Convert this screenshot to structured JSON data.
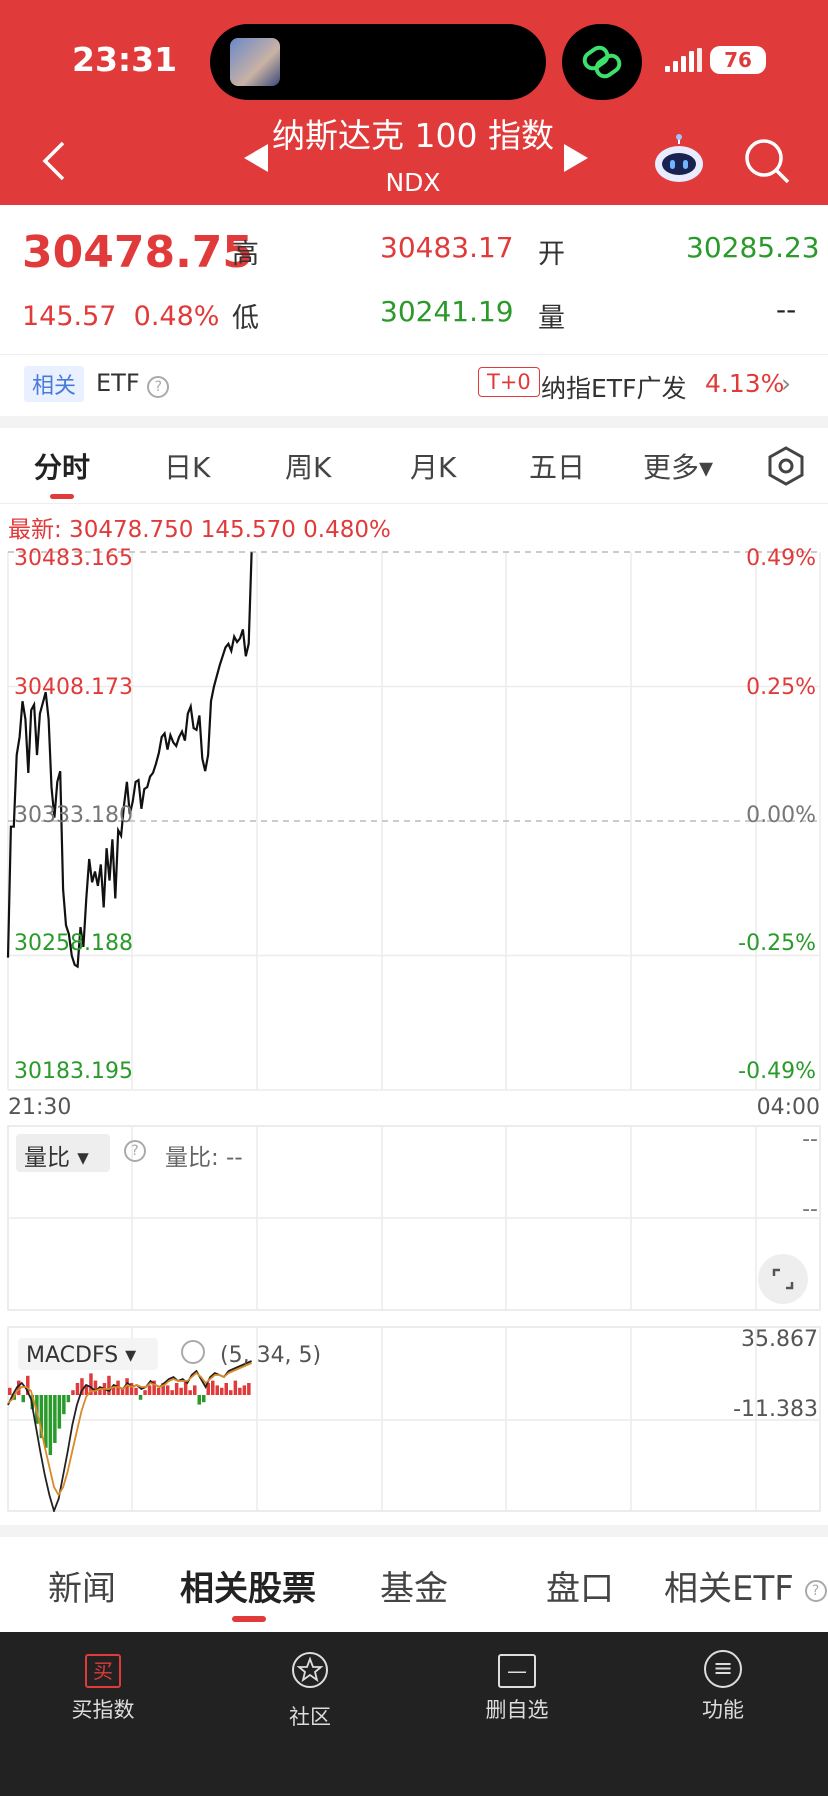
{
  "status": {
    "time": "23:31",
    "battery": "76"
  },
  "header": {
    "title": "纳斯达克 100 指数",
    "subtitle": "NDX"
  },
  "quote": {
    "price": "30478.75",
    "change": "145.57",
    "change_pct": "0.48%",
    "high_label": "高",
    "high": "30483.17",
    "open_label": "开",
    "open": "30285.23",
    "low_label": "低",
    "low": "30241.19",
    "volume_label": "量",
    "volume": "--"
  },
  "related": {
    "tag": "相关",
    "etf_label": "ETF",
    "t0_badge": "T+0",
    "fund_name": "纳指ETF广发",
    "fund_pct": "4.13%"
  },
  "period_tabs": [
    {
      "label": "分时",
      "active": true
    },
    {
      "label": "日K"
    },
    {
      "label": "周K"
    },
    {
      "label": "月K"
    },
    {
      "label": "五日"
    },
    {
      "label": "更多▾"
    }
  ],
  "latest_line": "最新: 30478.750  145.570  0.480%",
  "chart_data": {
    "type": "line",
    "x_start_label": "21:30",
    "x_end_label": "04:00",
    "y_labels": [
      "30483.165",
      "30408.173",
      "30333.180",
      "30258.188",
      "30183.195"
    ],
    "y_pct_labels": [
      "0.49%",
      "0.25%",
      "0.00%",
      "-0.25%",
      "-0.49%"
    ],
    "prev_close": 30333.18,
    "ylim": [
      30183.195,
      30483.165
    ],
    "x_session_fraction_shown": 0.3,
    "series": [
      {
        "values": [
          30257,
          30330,
          30330,
          30370,
          30380,
          30400,
          30390,
          30360,
          30395,
          30398,
          30370,
          30393,
          30399,
          30405,
          30390,
          30352,
          30335,
          30355,
          30361,
          30295,
          30275,
          30270,
          30258,
          30253,
          30252,
          30274,
          30263,
          30290,
          30312,
          30299,
          30305,
          30297,
          30309,
          30285,
          30318,
          30300,
          30323,
          30290,
          30328,
          30325,
          30342,
          30355,
          30337,
          30344,
          30355,
          30356,
          30340,
          30351,
          30352,
          30358,
          30360,
          30365,
          30371,
          30380,
          30382,
          30373,
          30381,
          30377,
          30375,
          30380,
          30383,
          30378,
          30393,
          30397,
          30385,
          30384,
          30392,
          30368,
          30361,
          30370,
          30400,
          30408,
          30414,
          30420,
          30425,
          30430,
          30432,
          30428,
          30436,
          30433,
          30435,
          30440,
          30425,
          30432,
          30483
        ]
      }
    ]
  },
  "volume_ratio": {
    "label": "量比",
    "text": "量比: --",
    "scale_top": "--",
    "scale_bottom": "--"
  },
  "macd": {
    "label": "MACDFS",
    "params": "(5, 34, 5)",
    "upper": "35.867",
    "lower": "-11.383",
    "hist": [
      3,
      -2,
      6,
      -3,
      8,
      -6,
      -12,
      -18,
      -22,
      -25,
      -20,
      -14,
      -8,
      -3,
      2,
      5,
      7,
      4,
      9,
      6,
      3,
      5,
      8,
      4,
      6,
      3,
      7,
      5,
      3,
      -2,
      2,
      4,
      6,
      3,
      5,
      4,
      2,
      5,
      3,
      6,
      2,
      4,
      -4,
      -3,
      5,
      6,
      4,
      3,
      5,
      2,
      6,
      3,
      4,
      5
    ],
    "dif": [
      -5,
      0,
      4,
      6,
      3,
      -2,
      -15,
      -28,
      -40,
      -50,
      -58,
      -52,
      -40,
      -28,
      -15,
      -5,
      2,
      5,
      4,
      2,
      4,
      3,
      2,
      5,
      4,
      3,
      6,
      4,
      5,
      3,
      4,
      7,
      5,
      4,
      6,
      8,
      9,
      7,
      8,
      6,
      10,
      12,
      8,
      4,
      9,
      11,
      10,
      9,
      12,
      13,
      14,
      15,
      16,
      17
    ],
    "dea": [
      -4,
      -2,
      2,
      4,
      4,
      2,
      -6,
      -15,
      -26,
      -36,
      -46,
      -50,
      -46,
      -38,
      -28,
      -18,
      -8,
      -1,
      2,
      2,
      3,
      3,
      3,
      4,
      4,
      3,
      5,
      4,
      5,
      4,
      4,
      6,
      5,
      4,
      5,
      7,
      8,
      7,
      7,
      7,
      9,
      11,
      9,
      6,
      8,
      10,
      10,
      9,
      11,
      12,
      13,
      14,
      15,
      16
    ]
  },
  "bottom_tabs": [
    {
      "label": "新闻"
    },
    {
      "label": "相关股票",
      "active": true
    },
    {
      "label": "基金"
    },
    {
      "label": "盘口"
    },
    {
      "label": "相关ETF"
    }
  ],
  "nav": [
    {
      "label": "买指数",
      "glyph": "买"
    },
    {
      "label": "社区"
    },
    {
      "label": "删自选",
      "glyph": "—"
    },
    {
      "label": "功能",
      "glyph": "≡"
    }
  ],
  "colors": {
    "red": "#e03a3a",
    "green": "#2a9a2a",
    "line": "#111111",
    "macd_dea": "#d98a2a"
  }
}
